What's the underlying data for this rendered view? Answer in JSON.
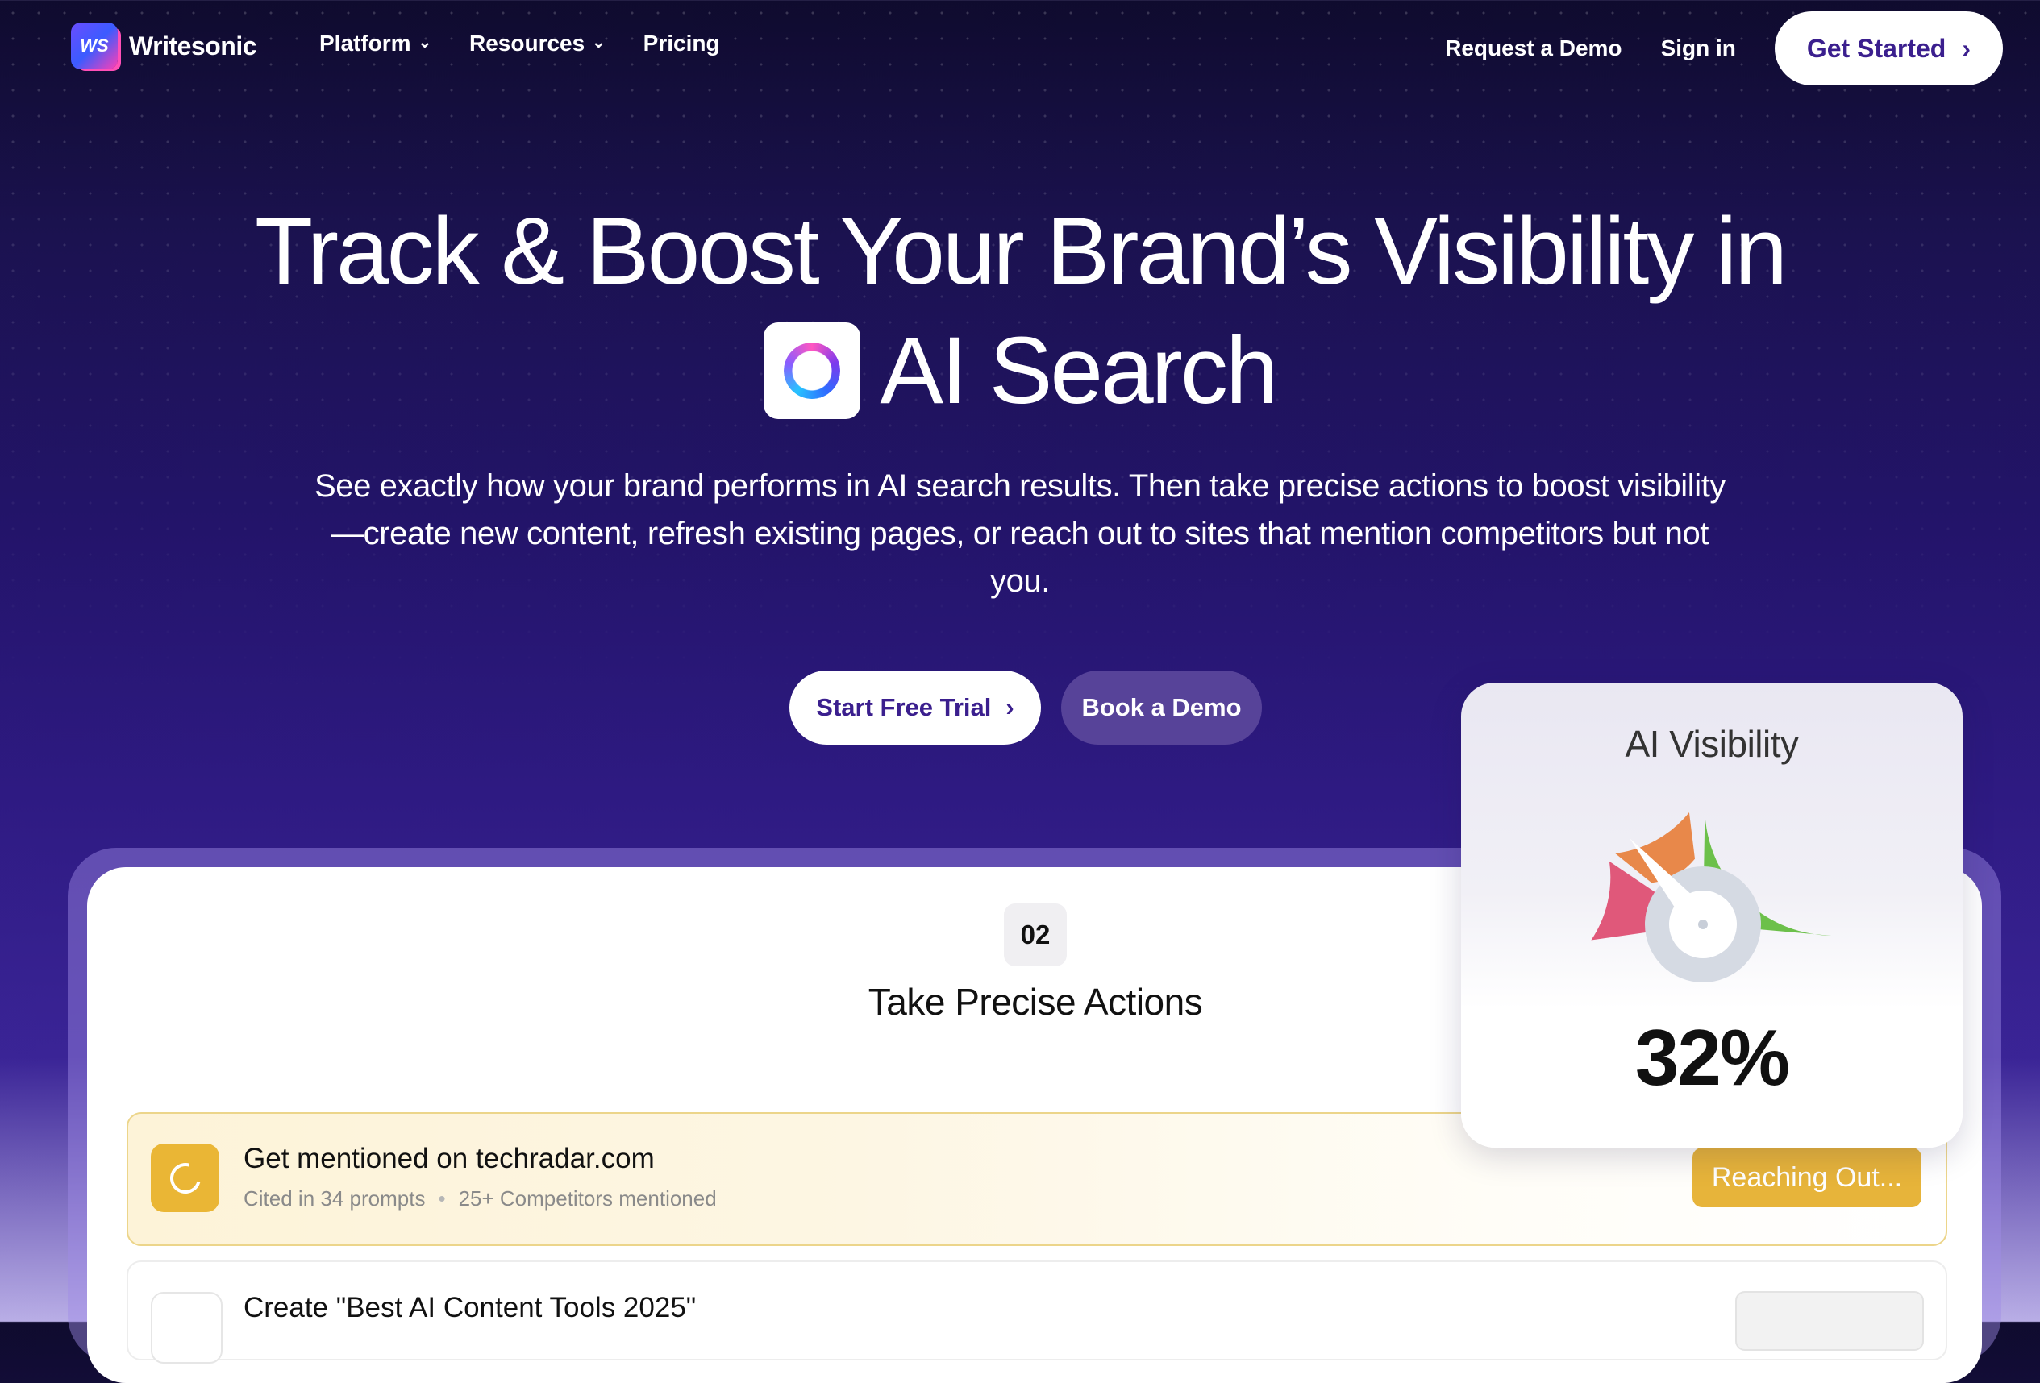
{
  "nav": {
    "brand": "Writesonic",
    "logo_mark": "WS",
    "links": [
      {
        "label": "Platform",
        "has_dropdown": true
      },
      {
        "label": "Resources",
        "has_dropdown": true
      },
      {
        "label": "Pricing",
        "has_dropdown": false
      }
    ],
    "request_demo": "Request a Demo",
    "sign_in": "Sign in",
    "get_started": "Get Started"
  },
  "hero": {
    "title_line1": "Track & Boost Your Brand’s Visibility in",
    "title_line2": "AI Search",
    "subtitle": "See exactly how your brand performs in AI search results. Then take precise actions to boost visibility—create new content, refresh existing pages, or reach out to sites that mention competitors but not you.",
    "cta_primary": "Start Free Trial",
    "cta_secondary": "Book a Demo"
  },
  "actions_panel": {
    "step_number": "02",
    "step_title": "Take Precise Actions",
    "items": [
      {
        "title": "Get mentioned on techradar.com",
        "meta1": "Cited in 34 prompts",
        "meta_sep": "•",
        "meta2": "25+ Competitors mentioned",
        "button": "Reaching Out...",
        "accent": "#e7b43a"
      },
      {
        "title": "Create \"Best AI Content Tools 2025\""
      }
    ]
  },
  "visibility_card": {
    "title": "AI Visibility",
    "value_text": "32%",
    "value": 32,
    "segments": [
      {
        "color": "#e0587a"
      },
      {
        "color": "#e8884a"
      },
      {
        "color": "#6cc04a"
      }
    ]
  },
  "colors": {
    "accent_purple": "#3b1f8e",
    "secondary_button": "#574399",
    "warning": "#e7b43a"
  }
}
